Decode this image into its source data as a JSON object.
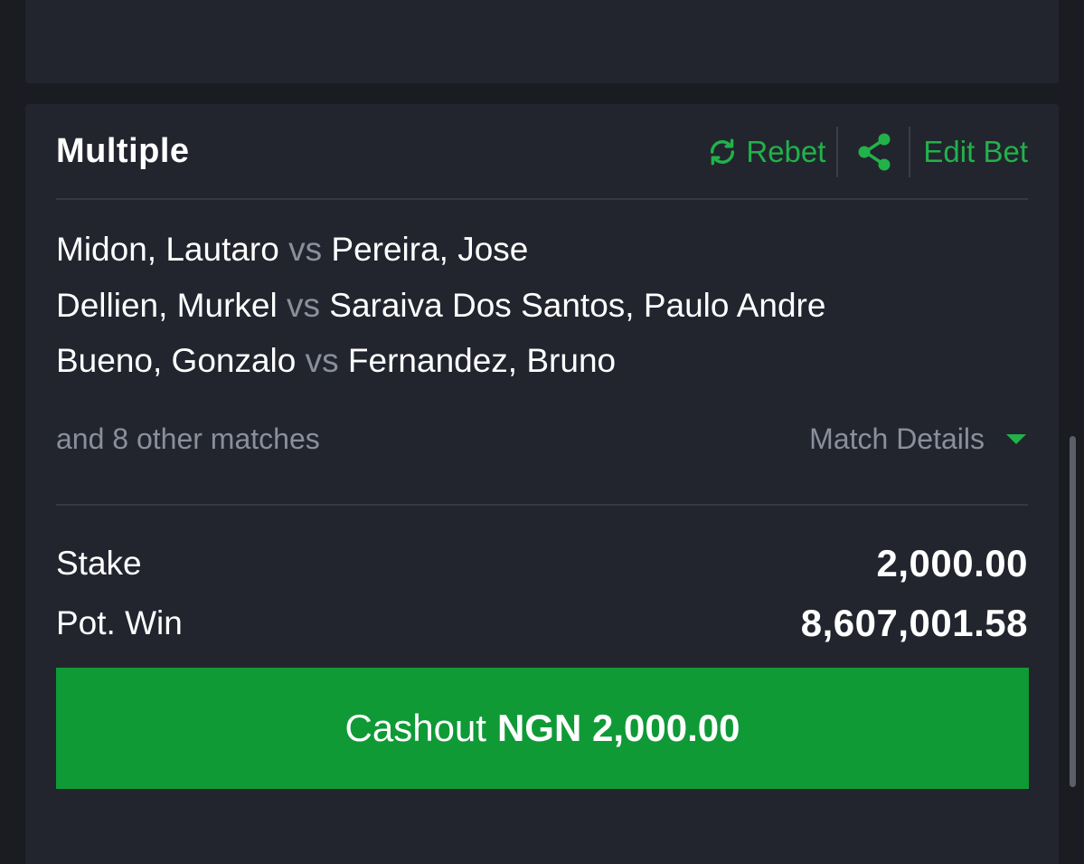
{
  "bet": {
    "type_label": "Multiple",
    "actions": {
      "rebet_label": "Rebet",
      "edit_label": "Edit Bet"
    },
    "matches": [
      {
        "home": "Midon, Lautaro",
        "vs": "vs",
        "away": "Pereira, Jose"
      },
      {
        "home": "Dellien, Murkel",
        "vs": "vs",
        "away": "Saraiva Dos Santos, Paulo Andre"
      },
      {
        "home": "Bueno, Gonzalo",
        "vs": "vs",
        "away": "Fernandez, Bruno"
      }
    ],
    "other_matches_text": "and 8 other matches",
    "match_details_label": "Match Details",
    "stake_label": "Stake",
    "stake_value": "2,000.00",
    "pot_win_label": "Pot. Win",
    "pot_win_value": "8,607,001.58",
    "cashout": {
      "label": "Cashout",
      "amount": "NGN 2,000.00"
    }
  },
  "colors": {
    "accent_green": "#21b24a",
    "cashout_bg": "#0f9a36",
    "card_bg": "#22252e",
    "page_bg": "#1a1c22",
    "muted_text": "#8a8f9c"
  }
}
